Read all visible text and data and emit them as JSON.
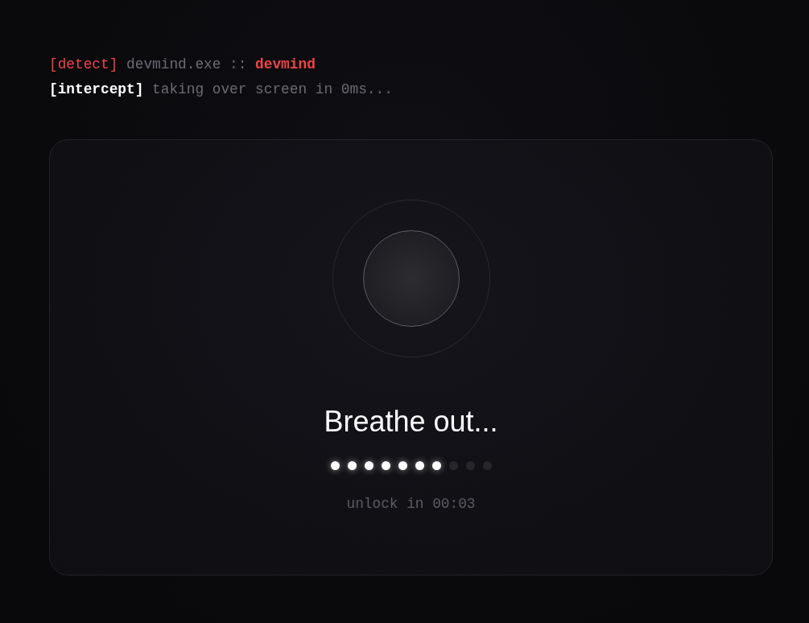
{
  "log": [
    {
      "kind": "alert",
      "tag": "[detect]",
      "message": "devmind.exe ::",
      "target": "devmind"
    },
    {
      "kind": "notice",
      "tag": "[intercept]",
      "message": "taking over screen in 0ms..."
    }
  ],
  "breath": {
    "prompt": "Breathe out...",
    "dots": [
      {
        "on": true
      },
      {
        "on": true
      },
      {
        "on": true
      },
      {
        "on": true
      },
      {
        "on": true
      },
      {
        "on": true
      },
      {
        "on": true
      },
      {
        "on": false
      },
      {
        "on": false
      },
      {
        "on": false
      }
    ],
    "countdown": "unlock in 00:03"
  }
}
